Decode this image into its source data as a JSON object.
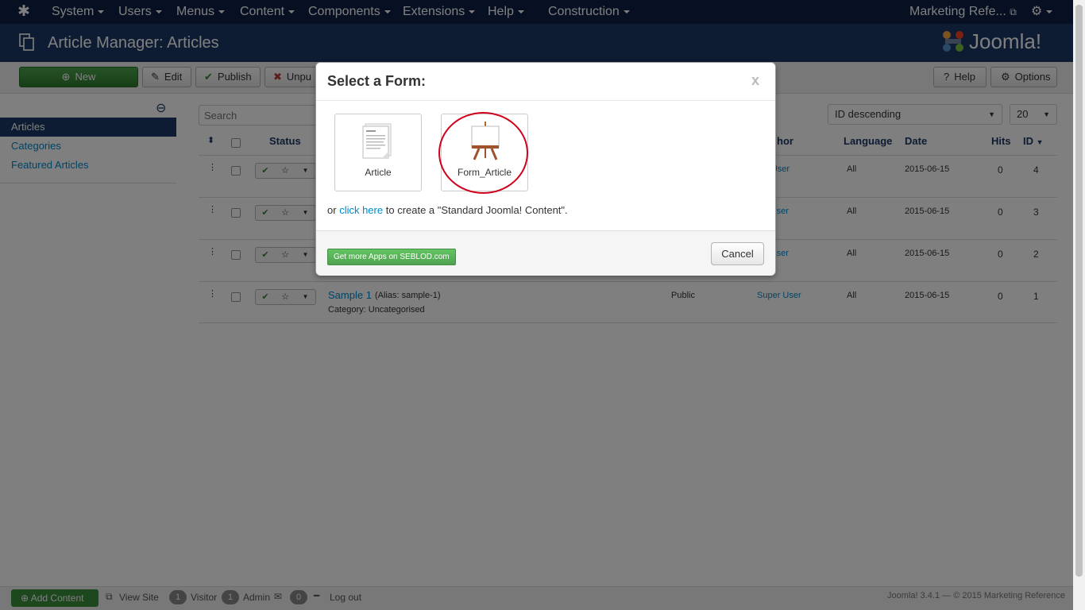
{
  "topnav": {
    "menus": [
      "System",
      "Users",
      "Menus",
      "Content",
      "Components",
      "Extensions",
      "Help",
      "Construction"
    ],
    "site_name": "Marketing Refe..."
  },
  "header": {
    "title": "Article Manager: Articles",
    "brand": "Joomla!"
  },
  "toolbar": {
    "new_label": "New",
    "edit_label": "Edit",
    "publish_label": "Publish",
    "unpublish_label": "Unpu",
    "help_label": "Help",
    "options_label": "Options"
  },
  "sidebar": {
    "items": [
      "Articles",
      "Categories",
      "Featured Articles"
    ]
  },
  "filters": {
    "search_placeholder": "Search",
    "sort_value": "ID descending",
    "limit_value": "20"
  },
  "table": {
    "columns": {
      "status": "Status",
      "author": "hor",
      "language": "Language",
      "date": "Date",
      "hits": "Hits",
      "id": "ID"
    },
    "rows": [
      {
        "author": "er User",
        "language": "All",
        "date": "2015-06-15",
        "hits": "0",
        "id": "4"
      },
      {
        "author": "r User",
        "language": "All",
        "date": "2015-06-15",
        "hits": "0",
        "id": "3"
      },
      {
        "author": "r User",
        "language": "All",
        "date": "2015-06-15",
        "hits": "0",
        "id": "2"
      },
      {
        "title": "Sample 1",
        "alias": "(Alias: sample-1)",
        "category": "Category: Uncategorised",
        "access": "Public",
        "author": "Super User",
        "language": "All",
        "date": "2015-06-15",
        "hits": "0",
        "id": "1"
      }
    ]
  },
  "modal": {
    "title": "Select a Form:",
    "close": "x",
    "forms": [
      "Article",
      "Form_Article"
    ],
    "text_prefix": "or",
    "link_text": "click here",
    "text_suffix": "to create a \"Standard Joomla! Content\".",
    "apps_button": "Get more Apps on SEBLOD.com",
    "cancel_button": "Cancel"
  },
  "footer": {
    "add_content": "Add Content",
    "view_site": "View Site",
    "visitor_count": "1",
    "visitor_label": "Visitor",
    "admin_count": "1",
    "admin_label": "Admin",
    "messages_count": "0",
    "logout_label": "Log out",
    "copyright": "Joomla! 3.4.1 — © 2015 Marketing Reference"
  },
  "colors": {
    "nav_bg": "#0c2144",
    "header_bg": "#1a3867",
    "new_button": "#3a8f3a",
    "highlight_circle": "#d0021b",
    "link": "#0088cc"
  }
}
